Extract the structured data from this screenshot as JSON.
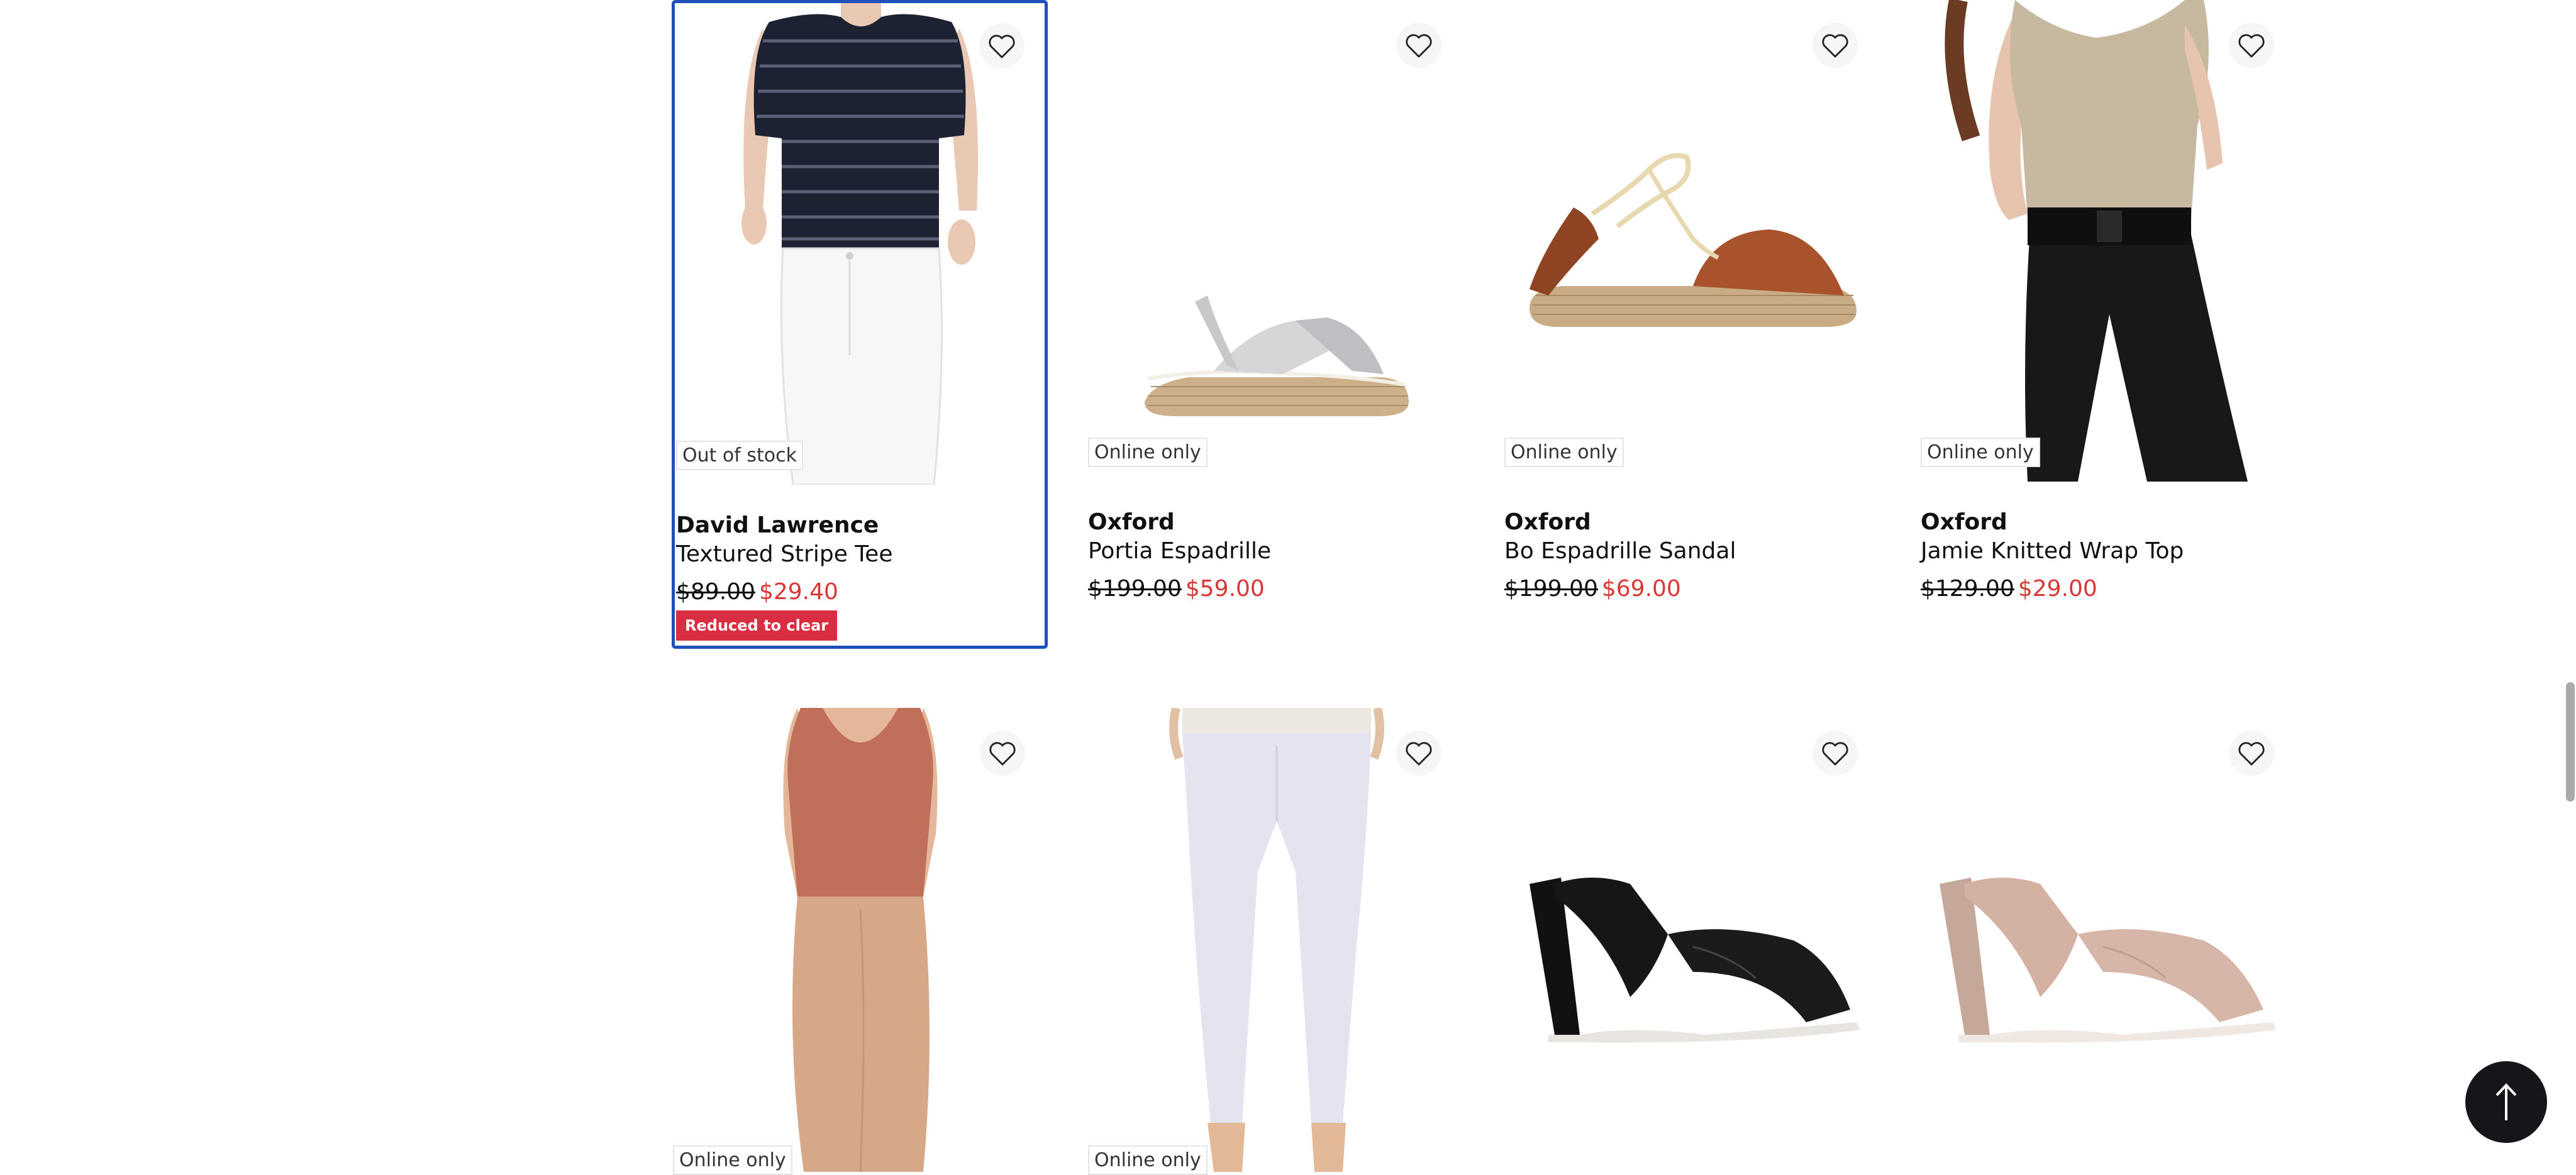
{
  "colors": {
    "accent": "#1f4fb8",
    "sale_price": "#d93636",
    "flag_bg": "#d92e42"
  },
  "row1": [
    {
      "brand": "David Lawrence",
      "name": "Textured Stripe Tee",
      "was": "$89.00",
      "now": "$29.40",
      "badge": "Out of stock",
      "flag": "Reduced to clear"
    },
    {
      "brand": "Oxford",
      "name": "Portia Espadrille",
      "was": "$199.00",
      "now": "$59.00",
      "badge": "Online only"
    },
    {
      "brand": "Oxford",
      "name": "Bo Espadrille Sandal",
      "was": "$199.00",
      "now": "$69.00",
      "badge": "Online only"
    },
    {
      "brand": "Oxford",
      "name": "Jamie Knitted Wrap Top",
      "was": "$129.00",
      "now": "$29.00",
      "badge": "Online only"
    }
  ],
  "row2": [
    {
      "badge": "Online only"
    },
    {
      "badge": "Online only"
    }
  ],
  "icons": {
    "wishlist": "heart-icon",
    "back_to_top": "arrow-up-icon"
  }
}
